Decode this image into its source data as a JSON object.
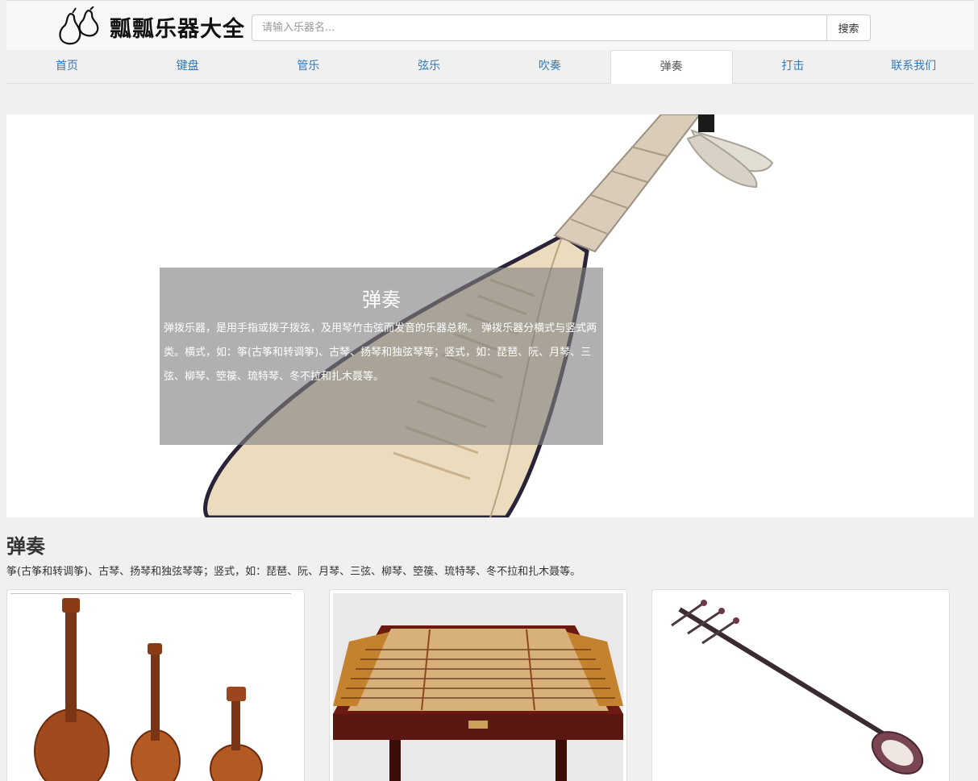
{
  "header": {
    "logo_text": "瓢瓢乐器大全",
    "search": {
      "placeholder": "请输入乐器名...",
      "value": ""
    },
    "search_button": "搜索"
  },
  "nav": {
    "tabs": [
      {
        "label": "首页",
        "active": false
      },
      {
        "label": "键盘",
        "active": false
      },
      {
        "label": "管乐",
        "active": false
      },
      {
        "label": "弦乐",
        "active": false
      },
      {
        "label": "吹奏",
        "active": false
      },
      {
        "label": "弹奏",
        "active": true
      },
      {
        "label": "打击",
        "active": false
      },
      {
        "label": "联系我们",
        "active": false
      }
    ]
  },
  "hero": {
    "title": "弹奏",
    "description": "弹拨乐器，是用手指或拨子拨弦，及用琴竹击弦而发音的乐器总称。 弹拨乐器分横式与竖式两类。横式，如：筝(古筝和转调筝)、古琴、扬琴和独弦琴等；竖式，如：琵琶、阮、月琴、三弦、柳琴、箜篌、琉特琴、冬不拉和扎木聂等。"
  },
  "section": {
    "title": "弹奏",
    "description": "筝(古筝和转调筝)、古琴、扬琴和独弦琴等；竖式，如：琵琶、阮、月琴、三弦、柳琴、箜篌、琉特琴、冬不拉和扎木聂等。"
  },
  "colors": {
    "link": "#337ab7",
    "overlay": "rgba(128,128,128,0.62)",
    "page_bg": "#f0f0f0"
  }
}
